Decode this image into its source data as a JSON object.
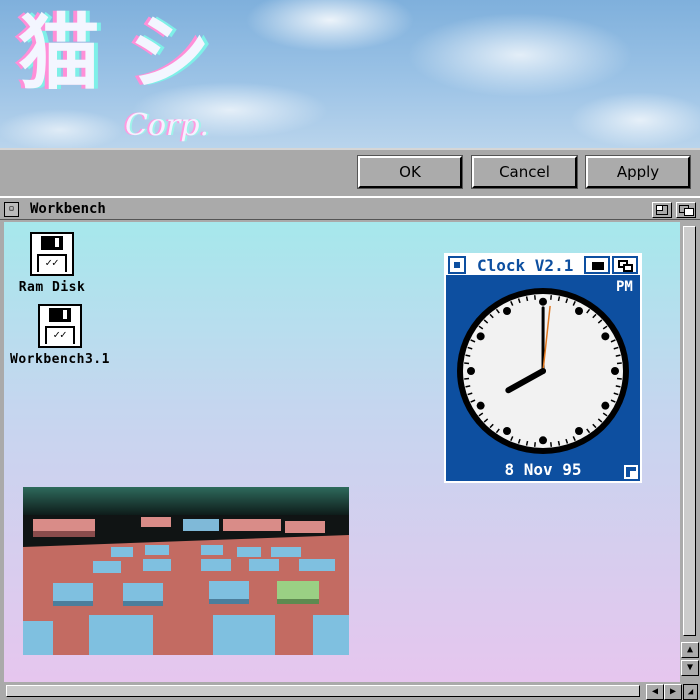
{
  "banner": {
    "logo_kanji": "猫 シ",
    "logo_corp": "Corp."
  },
  "dialog_buttons": {
    "ok": "OK",
    "cancel": "Cancel",
    "apply": "Apply"
  },
  "workbench": {
    "title": "Workbench",
    "icons": [
      {
        "label": "Ram Disk",
        "icon": "floppy-disk-icon"
      },
      {
        "label": "Workbench3.1",
        "icon": "floppy-disk-icon"
      }
    ]
  },
  "clock": {
    "title": "Clock  V2.1",
    "ampm": "PM",
    "date": "8 Nov 95",
    "time": {
      "hour": 8,
      "minute": 0,
      "second": 1
    }
  },
  "colors": {
    "clock_blue": "#0d4fa0",
    "desktop_top": "#a6e8ec",
    "desktop_bottom": "#e6c6ee",
    "chrome_gray": "#aaaaaa"
  },
  "scene": {
    "name": "3d-city-render-image"
  }
}
